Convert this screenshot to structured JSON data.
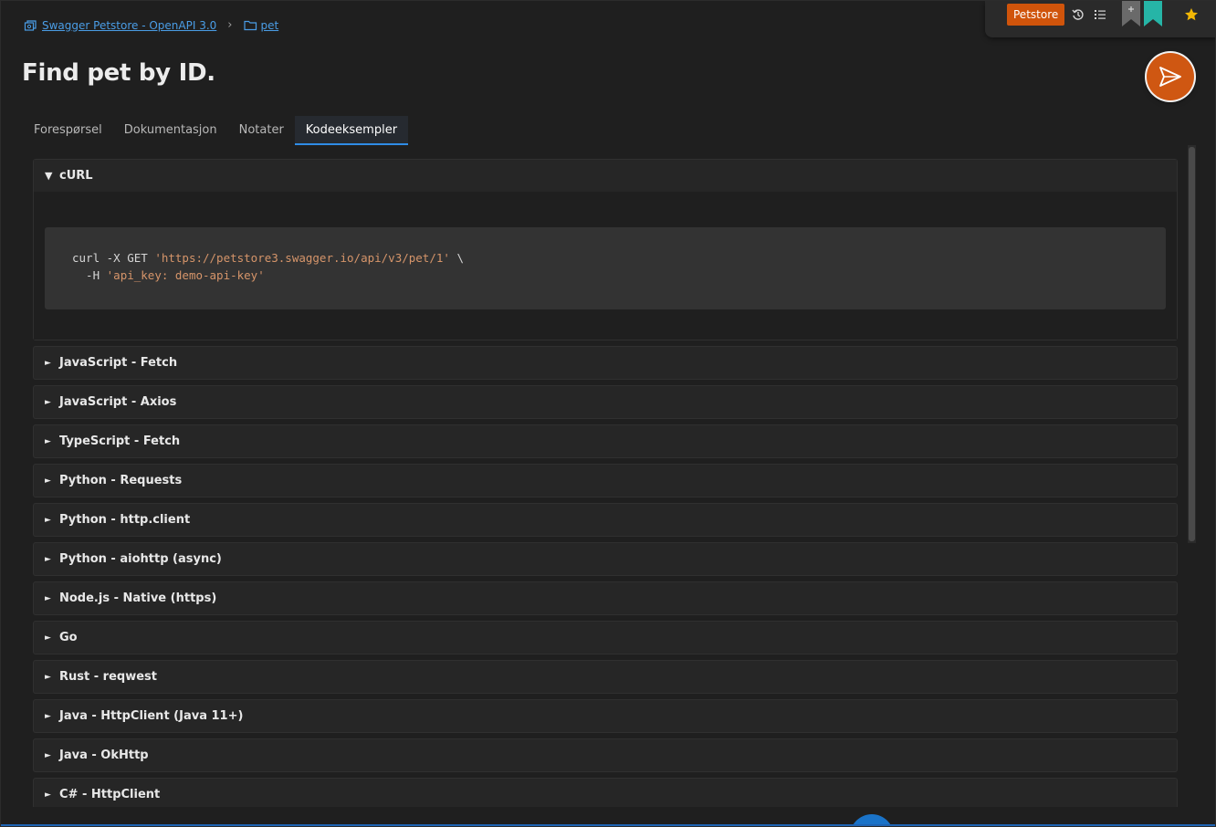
{
  "breadcrumb": {
    "collection": "Swagger Petstore - OpenAPI 3.0",
    "folder": "pet"
  },
  "title": "Find pet by ID.",
  "toolbar": {
    "environment": "Petstore",
    "icons": [
      "history-icon",
      "list-icon",
      "bookmark-add-icon",
      "bookmark-icon",
      "star-icon"
    ],
    "colors": {
      "environment": "#d0540b",
      "bookmark": "#26b5a7",
      "star": "#f2b705"
    }
  },
  "send_button": {
    "icon": "send-icon",
    "color": "#cf5712"
  },
  "tabs": [
    {
      "label": "Forespørsel",
      "active": false
    },
    {
      "label": "Dokumentasjon",
      "active": false
    },
    {
      "label": "Notater",
      "active": false
    },
    {
      "label": "Kodeeksempler",
      "active": true
    }
  ],
  "code_examples": {
    "open": {
      "label": "cURL",
      "code": {
        "line1_cmd": "curl -X GET ",
        "line1_url": "'https://petstore3.swagger.io/api/v3/pet/1'",
        "line1_tail": " \\",
        "line2_cmd": "  -H ",
        "line2_header": "'api_key: demo-api-key'"
      }
    },
    "collapsed": [
      "JavaScript - Fetch",
      "JavaScript - Axios",
      "TypeScript - Fetch",
      "Python - Requests",
      "Python - http.client",
      "Python - aiohttp (async)",
      "Node.js - Native (https)",
      "Go",
      "Rust - reqwest",
      "Java - HttpClient (Java 11+)",
      "Java - OkHttp",
      "C# - HttpClient"
    ]
  }
}
